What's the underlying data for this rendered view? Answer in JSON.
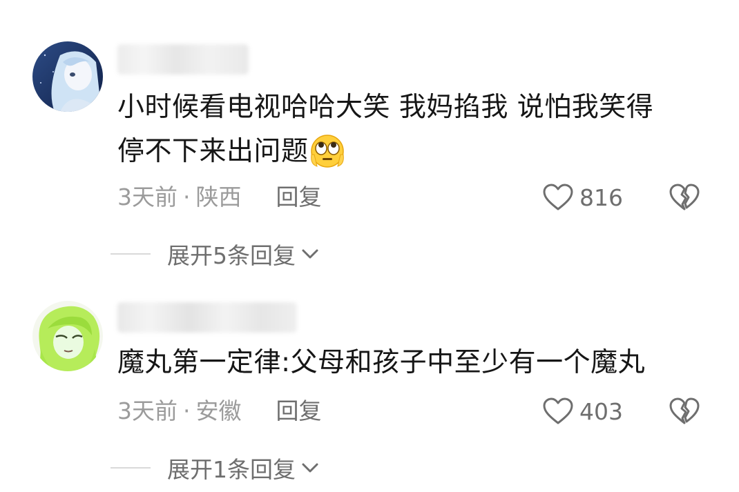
{
  "comments": [
    {
      "text_line1": "小时候看电视哈哈大笑 我妈掐我 说怕我笑得",
      "text_line2": "停不下来出问题",
      "emoji_icon": "eye-roll-emoji-icon",
      "time": "3天前",
      "separator": "·",
      "location": "陕西",
      "reply_label": "回复",
      "likes": "816",
      "expand_label": "展开5条回复"
    },
    {
      "text_line1": "魔丸第一定律:父母和孩子中至少有一个魔丸",
      "time": "3天前",
      "separator": "·",
      "location": "安徽",
      "reply_label": "回复",
      "likes": "403",
      "expand_label": "展开1条回复"
    }
  ],
  "colors": {
    "text": "#161616",
    "meta": "#9b9b9b",
    "action": "#6e6e6e"
  }
}
